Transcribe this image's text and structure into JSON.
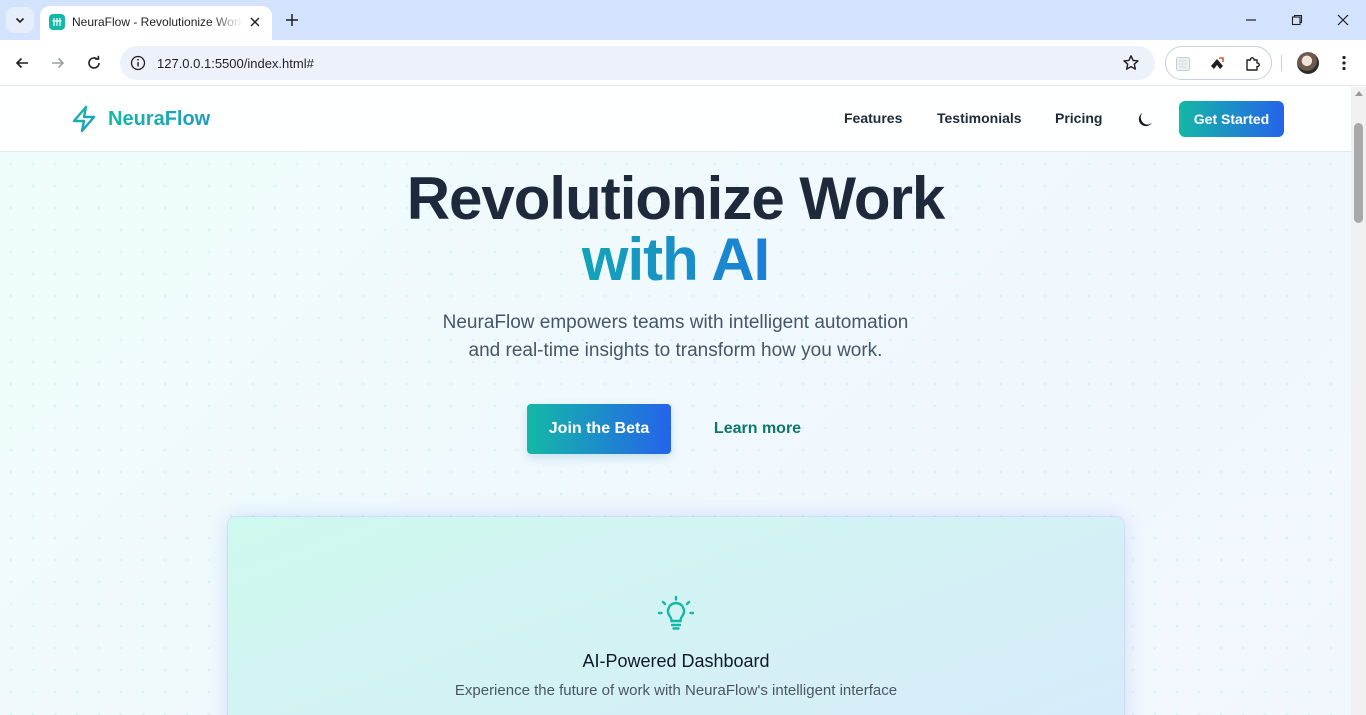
{
  "browser": {
    "tab_title": "NeuraFlow - Revolutionize Work with AI",
    "url": "127.0.0.1:5500/index.html#"
  },
  "header": {
    "brand": "NeuraFlow",
    "nav": [
      "Features",
      "Testimonials",
      "Pricing"
    ],
    "cta": "Get Started"
  },
  "hero": {
    "title_line1": "Revolutionize Work",
    "title_line2": "with AI",
    "subtitle_line1": "NeuraFlow empowers teams with intelligent automation",
    "subtitle_line2": "and real-time insights to transform how you work.",
    "primary_button": "Join the Beta",
    "secondary_button": "Learn more"
  },
  "preview": {
    "title": "AI-Powered Dashboard",
    "description": "Experience the future of work with NeuraFlow's intelligent interface"
  },
  "colors": {
    "brand": "#14b8a6",
    "accent_blue": "#2563eb"
  }
}
